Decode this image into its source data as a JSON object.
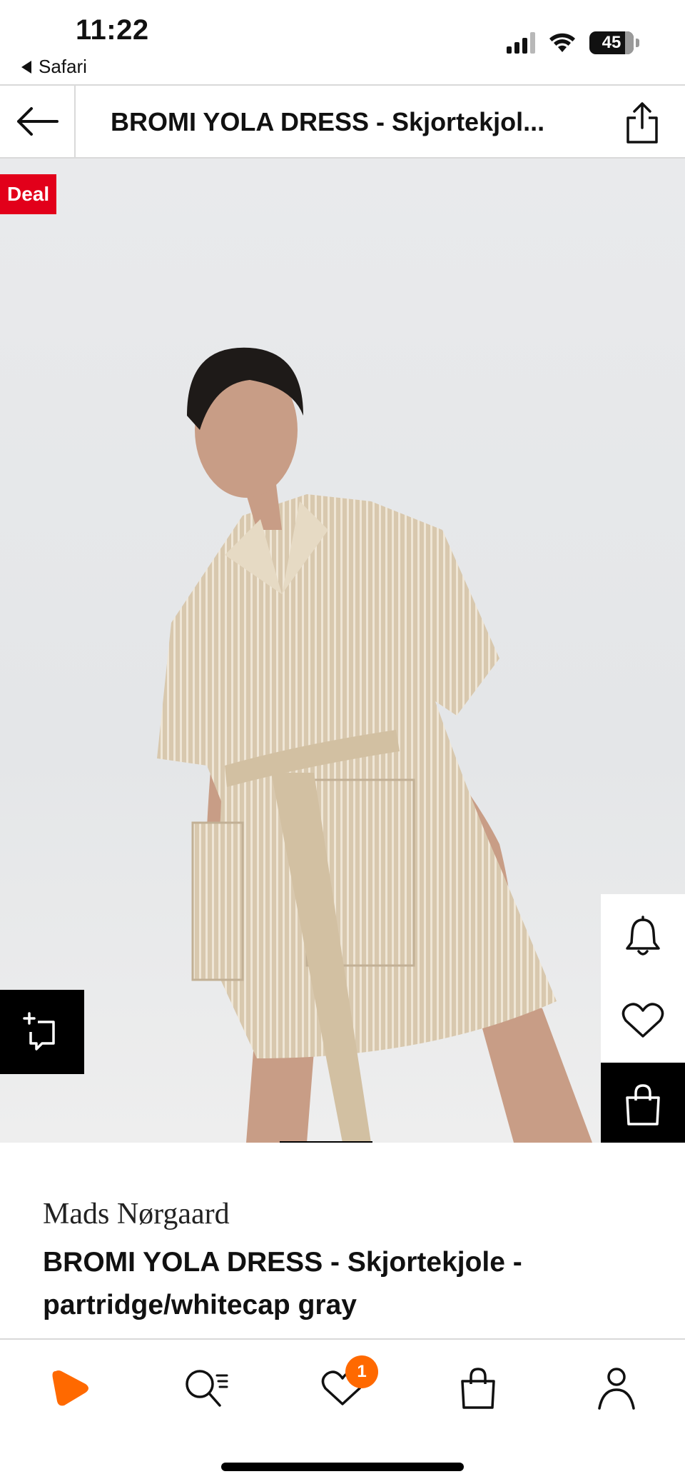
{
  "status_bar": {
    "time": "11:22",
    "back_app": "Safari",
    "battery": "45"
  },
  "header": {
    "title": "BROMI YOLA DRESS - Skjortekjol..."
  },
  "image": {
    "deal_label": "Deal",
    "dress_color": "#d9c9b0",
    "background": "#e8e9eb"
  },
  "product": {
    "brand": "Mads Nørgaard",
    "name": "BROMI YOLA DRESS - Skjortekjole - partridge/whitecap gray"
  },
  "tab_bar": {
    "wishlist_count": "1",
    "accent": "#ff6900"
  },
  "icons": [
    "arrow-left-icon",
    "share-icon",
    "compare-icon",
    "bell-icon",
    "heart-icon",
    "bag-icon",
    "play-logo-icon",
    "search-icon",
    "user-icon"
  ]
}
